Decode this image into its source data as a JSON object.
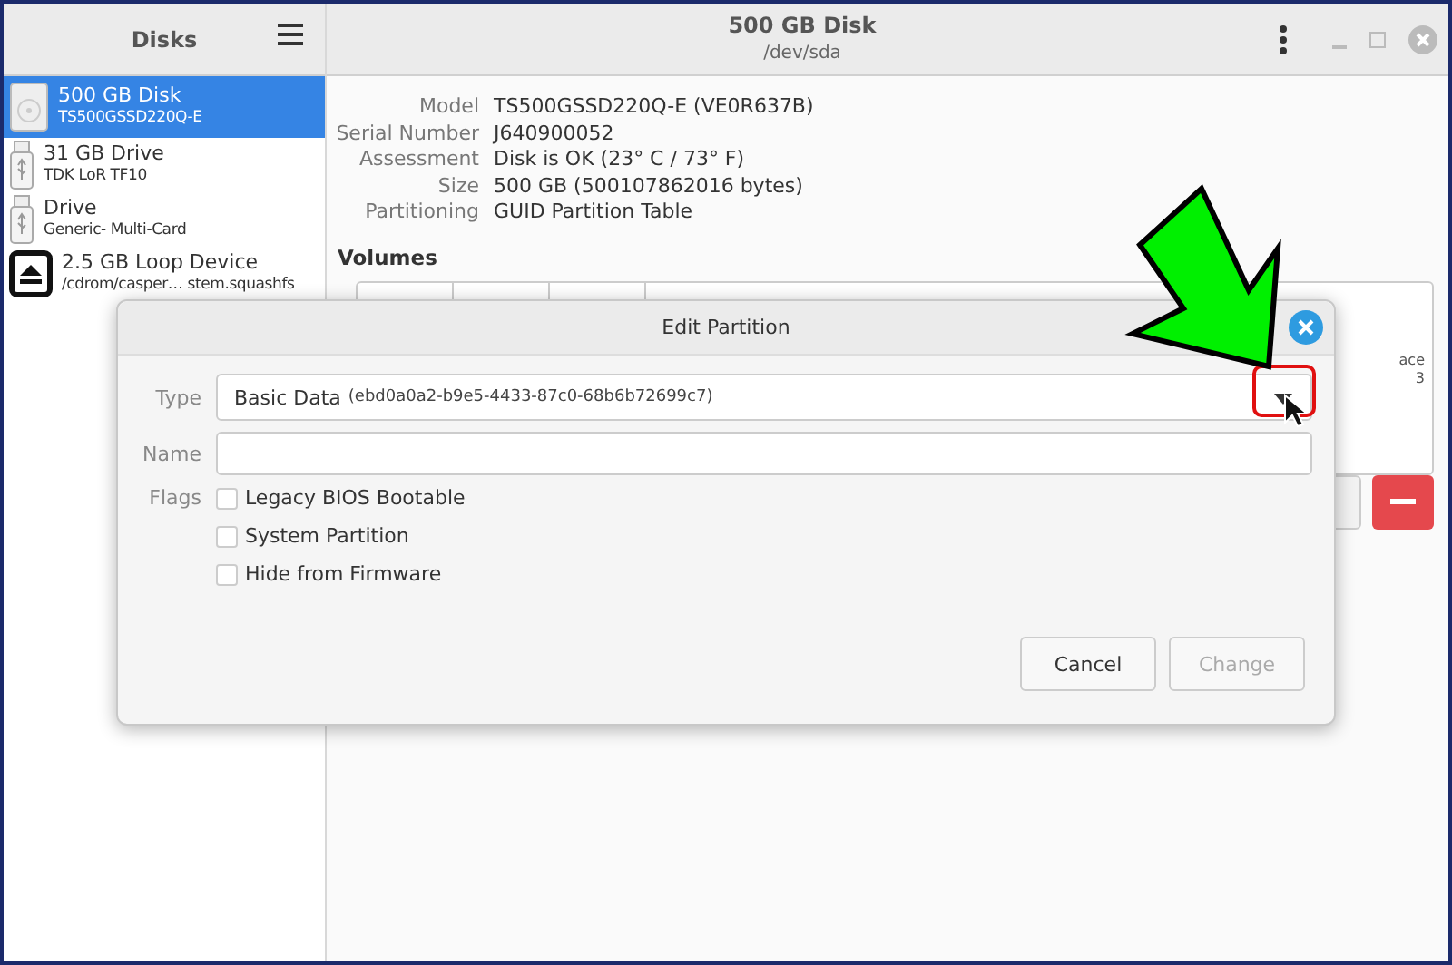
{
  "sidebar": {
    "title": "Disks",
    "items": [
      {
        "kind": "disk",
        "name": "500 GB Disk",
        "detail": "TS500GSSD220Q-E",
        "selected": true
      },
      {
        "kind": "usb",
        "name": "31 GB Drive",
        "detail": "TDK LoR TF10",
        "selected": false
      },
      {
        "kind": "usb",
        "name": "Drive",
        "detail": "Generic- Multi-Card",
        "selected": false
      },
      {
        "kind": "loop",
        "name": "2.5 GB Loop Device",
        "detail": "/cdrom/casper… stem.squashfs",
        "selected": false
      }
    ]
  },
  "header": {
    "title": "500 GB Disk",
    "subtitle": "/dev/sda"
  },
  "properties": [
    {
      "label": "Model",
      "value": "TS500GSSD220Q-E (VE0R637B)"
    },
    {
      "label": "Serial Number",
      "value": "J640900052"
    },
    {
      "label": "Assessment",
      "value": "Disk is OK (23° C / 73° F)"
    },
    {
      "label": "Size",
      "value": "500 GB (500107862016 bytes)"
    },
    {
      "label": "Partitioning",
      "value": "GUID Partition Table"
    }
  ],
  "volumes": {
    "title": "Volumes",
    "fragments": [
      "ace",
      "3"
    ]
  },
  "dialog": {
    "title": "Edit Partition",
    "type_label": "Type",
    "type_value": "Basic Data",
    "type_guid": "(ebd0a0a2-b9e5-4433-87c0-68b6b72699c7)",
    "name_label": "Name",
    "flags_label": "Flags",
    "flags": [
      {
        "label": "Legacy BIOS Bootable",
        "checked": false
      },
      {
        "label": "System Partition",
        "checked": false
      },
      {
        "label": "Hide from Firmware",
        "checked": false
      }
    ],
    "buttons": [
      {
        "label": "Cancel",
        "disabled": false
      },
      {
        "label": "Change",
        "disabled": true
      }
    ]
  }
}
